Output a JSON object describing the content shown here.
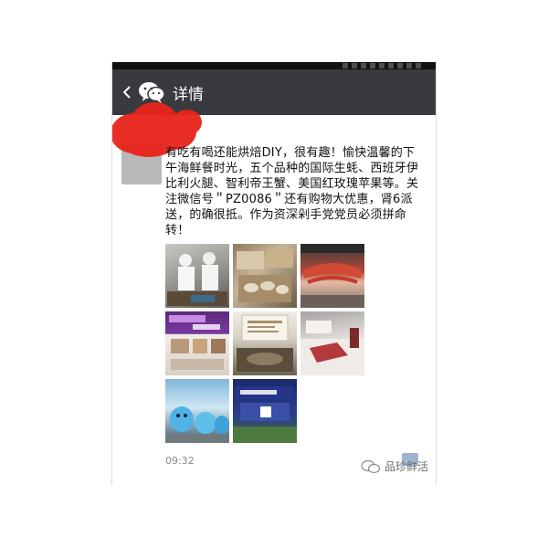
{
  "nav": {
    "back_icon": "chevron-left-icon",
    "app_icon": "wechat-icon",
    "title": "详情"
  },
  "post": {
    "text": "有吃有喝还能烘焙DIY，很有趣！愉快温馨的下\n午海鲜餐时光，五个品种的国际生蚝、西班牙伊\n比利火腿、智利帝王蟹、美国红玫瑰苹果等。关\n注微信号＂PZ0086＂还有购物大优惠，肾6派\n送，的确很抵。作为资深剁手党党员必须拼命\n转！",
    "timestamp": "09:32",
    "photos": [
      {
        "label": "",
        "theme": "chefs-buffet"
      },
      {
        "label": "",
        "theme": "oysters-platter"
      },
      {
        "label": "",
        "theme": "king-crab"
      },
      {
        "label": "",
        "theme": "event-poster"
      },
      {
        "label": "",
        "theme": "menu-card"
      },
      {
        "label": "",
        "theme": "ham-table"
      },
      {
        "label": "",
        "theme": "mascots"
      },
      {
        "label": "",
        "theme": "banner"
      }
    ]
  },
  "watermark": {
    "icon": "wechat-icon",
    "text": "品珍鲜活"
  },
  "colors": {
    "navbar": "#393a3f",
    "redact": "#e8251c",
    "timestamp": "#8a8a8a"
  }
}
